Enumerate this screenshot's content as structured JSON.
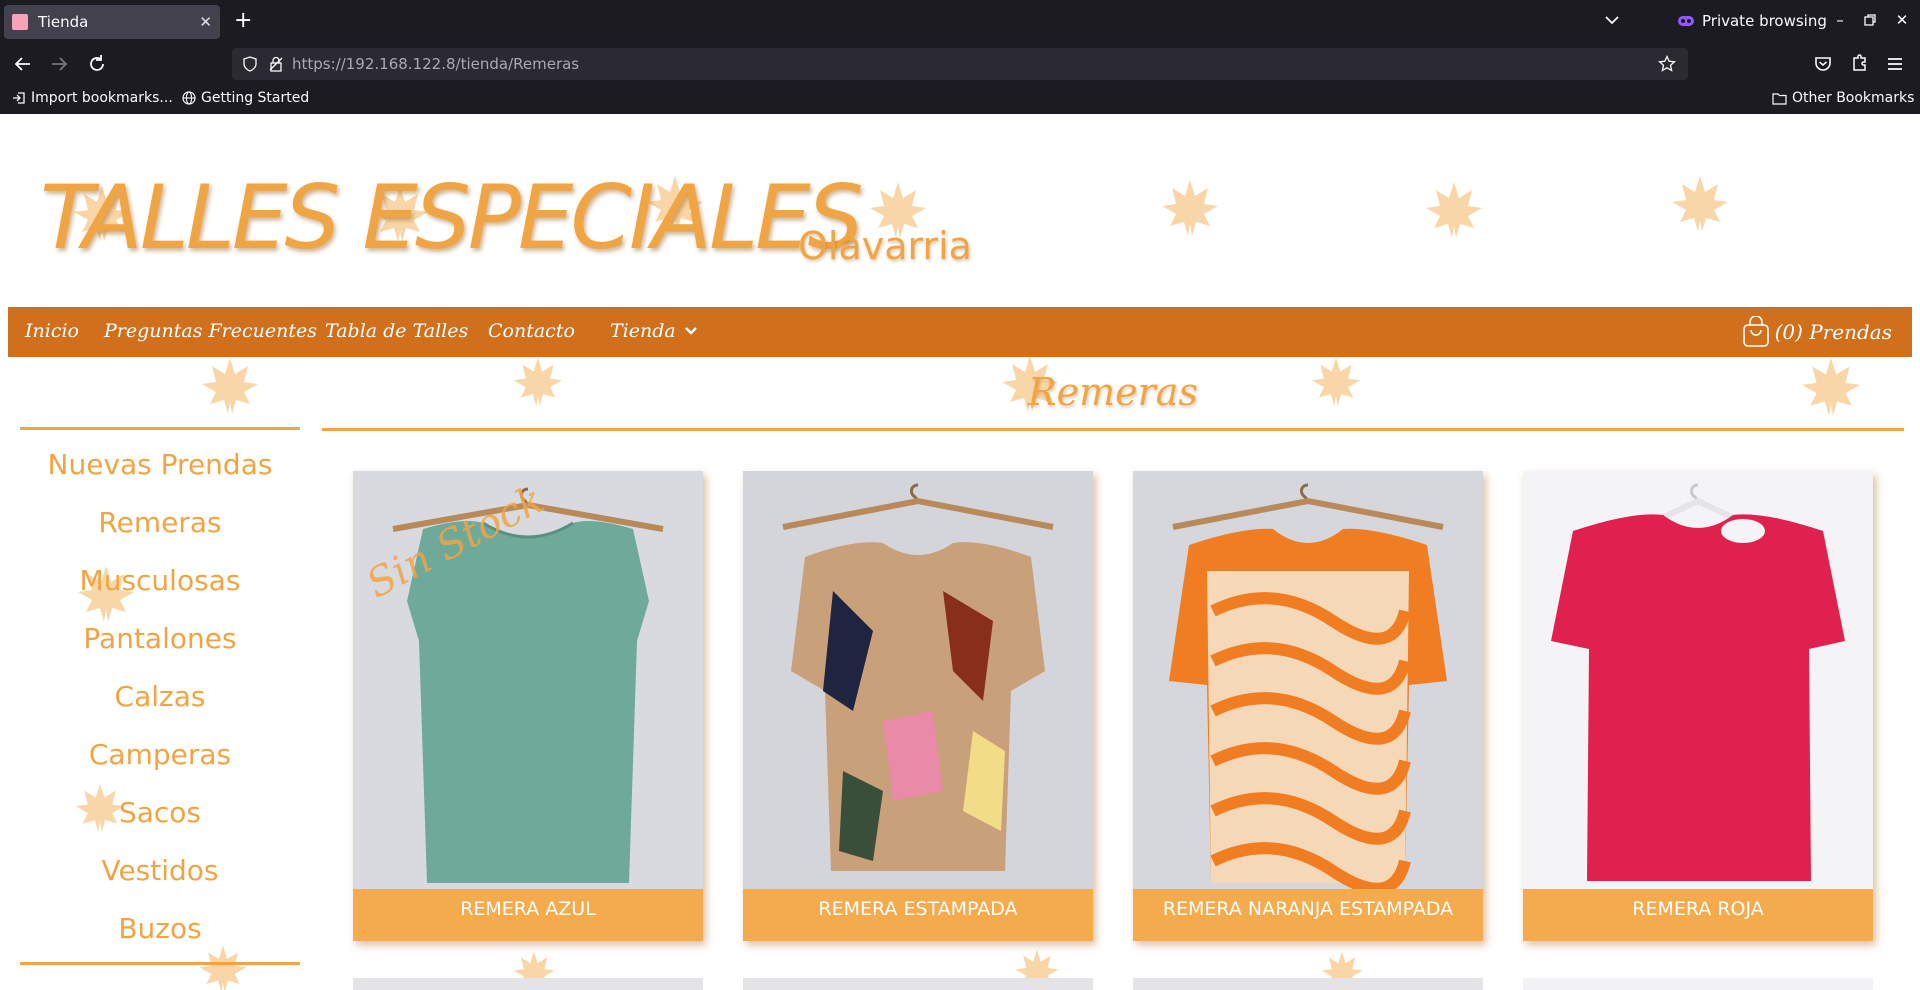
{
  "browser": {
    "tab_title": "Tienda",
    "private_label": "Private browsing",
    "url_host": "https://192.168.122.8",
    "url_path": "/tienda/Remeras",
    "bookmarks": {
      "import": "Import bookmarks...",
      "getting_started": "Getting Started",
      "other": "Other Bookmarks"
    }
  },
  "site": {
    "title": "TALLES ESPECIALES",
    "subtitle": "Olavarria",
    "nav": {
      "inicio": "Inicio",
      "faq": "Preguntas Frecuentes",
      "talles": "Tabla de Talles",
      "contacto": "Contacto",
      "tienda": "Tienda"
    },
    "cart_label": "(0) Prendas"
  },
  "sidebar": {
    "categories": [
      {
        "label": "Nuevas Prendas"
      },
      {
        "label": "Remeras"
      },
      {
        "label": "Musculosas"
      },
      {
        "label": "Pantalones"
      },
      {
        "label": "Calzas"
      },
      {
        "label": "Camperas"
      },
      {
        "label": "Sacos"
      },
      {
        "label": "Vestidos"
      },
      {
        "label": "Buzos"
      }
    ]
  },
  "main": {
    "section_title": "Remeras",
    "products": [
      {
        "name": "REMERA AZUL",
        "badge": "Sin Stock",
        "color": "#6fa99a"
      },
      {
        "name": "REMERA ESTAMPADA",
        "badge": "",
        "color": "#c8a07a"
      },
      {
        "name": "REMERA NARANJA ESTAMPADA",
        "badge": "",
        "color": "#f08a3a"
      },
      {
        "name": "REMERA ROJA",
        "badge": "",
        "color": "#e0204e"
      }
    ]
  },
  "colors": {
    "accent": "#f0a545",
    "nav_bg": "#d0701c",
    "label_bg": "#f3ab4e"
  }
}
